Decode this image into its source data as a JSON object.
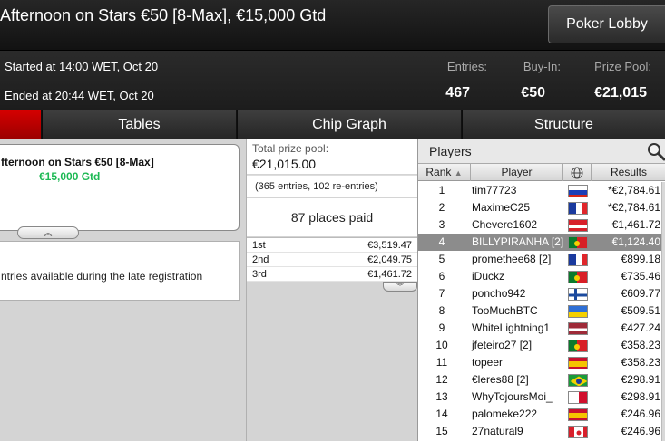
{
  "window": {
    "title": "Afternoon on Stars €50 [8-Max], €15,000 Gtd",
    "lobby_button": "Poker Lobby"
  },
  "info": {
    "started": "Started at 14:00 WET, Oct 20",
    "ended": "Ended at 20:44 WET, Oct 20",
    "entries_label": "Entries:",
    "entries_value": "467",
    "buyin_label": "Buy-In:",
    "buyin_value": "€50",
    "prize_label": "Prize Pool:",
    "prize_value": "€21,015"
  },
  "tabs": [
    {
      "label": "",
      "active": true
    },
    {
      "label": "Tables",
      "active": false
    },
    {
      "label": "Chip Graph",
      "active": false
    },
    {
      "label": "Structure",
      "active": false
    }
  ],
  "card": {
    "name": "fternoon on Stars €50 [8-Max]",
    "gtd": "€15,000 Gtd",
    "expander": "︽"
  },
  "late_reg_text": "ntries available during the late registration",
  "prize": {
    "total_label": "Total prize pool:",
    "total_value": "€21,015.00",
    "entries_note": "(365 entries, 102 re-entries)",
    "places_paid": "87 places paid",
    "payouts": [
      {
        "place": "1st",
        "amount": "€3,519.47"
      },
      {
        "place": "2nd",
        "amount": "€2,049.75"
      },
      {
        "place": "3rd",
        "amount": "€1,461.72"
      }
    ],
    "expander": "︾"
  },
  "players": {
    "title": "Players",
    "columns": {
      "rank": "Rank",
      "player": "Player",
      "results": "Results"
    },
    "rows": [
      {
        "rank": "1",
        "name": "tim77723",
        "flag": "ru",
        "result": "*€2,784.61",
        "selected": false
      },
      {
        "rank": "2",
        "name": "MaximeC25",
        "flag": "fr",
        "result": "*€2,784.61",
        "selected": false
      },
      {
        "rank": "3",
        "name": "Chevere1602",
        "flag": "at",
        "result": "€1,461.72",
        "selected": false
      },
      {
        "rank": "4",
        "name": "BILLYPIRANHA [2]",
        "flag": "pt",
        "result": "€1,124.40",
        "selected": true
      },
      {
        "rank": "5",
        "name": "promethee68 [2]",
        "flag": "fr",
        "result": "€899.18",
        "selected": false
      },
      {
        "rank": "6",
        "name": "iDuckz",
        "flag": "pt",
        "result": "€735.46",
        "selected": false
      },
      {
        "rank": "7",
        "name": "poncho942",
        "flag": "fi",
        "result": "€609.77",
        "selected": false
      },
      {
        "rank": "8",
        "name": "TooMuchBTC",
        "flag": "ua",
        "result": "€509.51",
        "selected": false
      },
      {
        "rank": "9",
        "name": "WhiteLightning1",
        "flag": "lv",
        "result": "€427.24",
        "selected": false
      },
      {
        "rank": "10",
        "name": "jfeteiro27 [2]",
        "flag": "pt",
        "result": "€358.23",
        "selected": false
      },
      {
        "rank": "11",
        "name": "topeer",
        "flag": "es",
        "result": "€358.23",
        "selected": false
      },
      {
        "rank": "12",
        "name": "€leres88 [2]",
        "flag": "br",
        "result": "€298.91",
        "selected": false
      },
      {
        "rank": "13",
        "name": "WhyTojoursMoi_",
        "flag": "mt",
        "result": "€298.91",
        "selected": false
      },
      {
        "rank": "14",
        "name": "palomeke222",
        "flag": "es",
        "result": "€246.96",
        "selected": false
      },
      {
        "rank": "15",
        "name": "27natural9",
        "flag": "ca",
        "result": "€246.96",
        "selected": false
      }
    ]
  },
  "colors": {
    "active_tab": "#c80000",
    "gtd_green": "#1db954",
    "selected_row": "#8c8c8c"
  }
}
